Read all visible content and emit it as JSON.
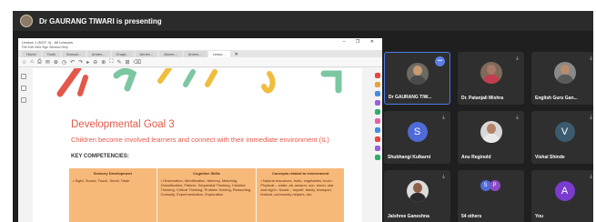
{
  "banner": {
    "presenter_text": "Dr GAURANG TIWARI is presenting"
  },
  "share": {
    "window_title": "Lesson 1 (NCF, 4) - All Lessons",
    "window_buttons": "–  ❐  ✕",
    "menu": "File  Edit  View  Sign  Window  Help",
    "tabs": [
      "Home",
      "Tools",
      "Annual...",
      "Annex...",
      "Chapt...",
      "Annex...",
      "Annex...",
      "Annex...",
      "Lesso..."
    ],
    "tab_close": "✕",
    "toolbar_icons": [
      "☆",
      "⌂",
      "⎙",
      "✉",
      "⊕",
      "◷",
      "↶",
      "↷",
      "▸",
      "⊖",
      "⊕",
      "⛶",
      "✎",
      "⊞",
      "⌫"
    ],
    "page": {
      "goal_title": "Developmental Goal 3",
      "goal_subtitle": "Children become involved learners and connect with their immediate environment (IL)",
      "key_competencies": "KEY COMPETENCIES:",
      "table": [
        {
          "header": "Sensory Development",
          "body": "• Sight, Sound, Touch, Smell, Taste"
        },
        {
          "header": "Cognitive Skills",
          "body": "• Observation, Identification, Memory, Matching, Classification, Pattern, Sequential Thinking, Creative Thinking, Critical Thinking, Problem Solving, Reasoning, Curiosity, Experimentation, Exploration"
        },
        {
          "header": "Concepts related to environment",
          "body": "• Natural resources, fruits, vegetables, food • Physical – water, air, season, sun, moon, star and night • Social – myself, family, transport, festival, community helpers, etc."
        }
      ]
    }
  },
  "participants": [
    {
      "name": "Dr GAURANG TIW...",
      "kind": "photo",
      "active": true,
      "more": "•••",
      "skin": "#c79a74",
      "shirt": "#4a4a4a",
      "bg": "#6d6a62"
    },
    {
      "name": "Dr. Patanjali Mishra",
      "kind": "photo",
      "mic": "⏚",
      "skin": "#a5786a",
      "shirt": "#c33d50",
      "bg": "#7f6a5a"
    },
    {
      "name": "English Guru Gan...",
      "kind": "photo",
      "mic": "⏚",
      "skin": "#b98c6a",
      "shirt": "#5a5a5a",
      "bg": "#8a8a8a"
    },
    {
      "name": "Shubhangi Kulkarni",
      "kind": "letter",
      "letter": "S",
      "color": "#4f6bd8",
      "mic": "⏚"
    },
    {
      "name": "Anu Reginold",
      "kind": "photo",
      "mic": "⏚",
      "skin": "#b58266",
      "shirt": "#e9e9e9",
      "bg": "#d7d7d7"
    },
    {
      "name": "Vishal Shinde",
      "kind": "letter",
      "letter": "V",
      "color": "#3d5b6e",
      "mic": "⏚"
    },
    {
      "name": "Jalshree Ganeshna",
      "kind": "photo",
      "mic": "⏚",
      "skin": "#8f6048",
      "shirt": "#2a2a2a",
      "bg": "#dcdcdc"
    },
    {
      "name": "54 others",
      "kind": "others",
      "letters": [
        "S",
        "P"
      ],
      "colors": [
        "#4f6bd8",
        "#8b4cc7"
      ]
    },
    {
      "name": "You",
      "kind": "letter",
      "letter": "A",
      "color": "#7a3bcf",
      "mic": "⏚"
    }
  ]
}
